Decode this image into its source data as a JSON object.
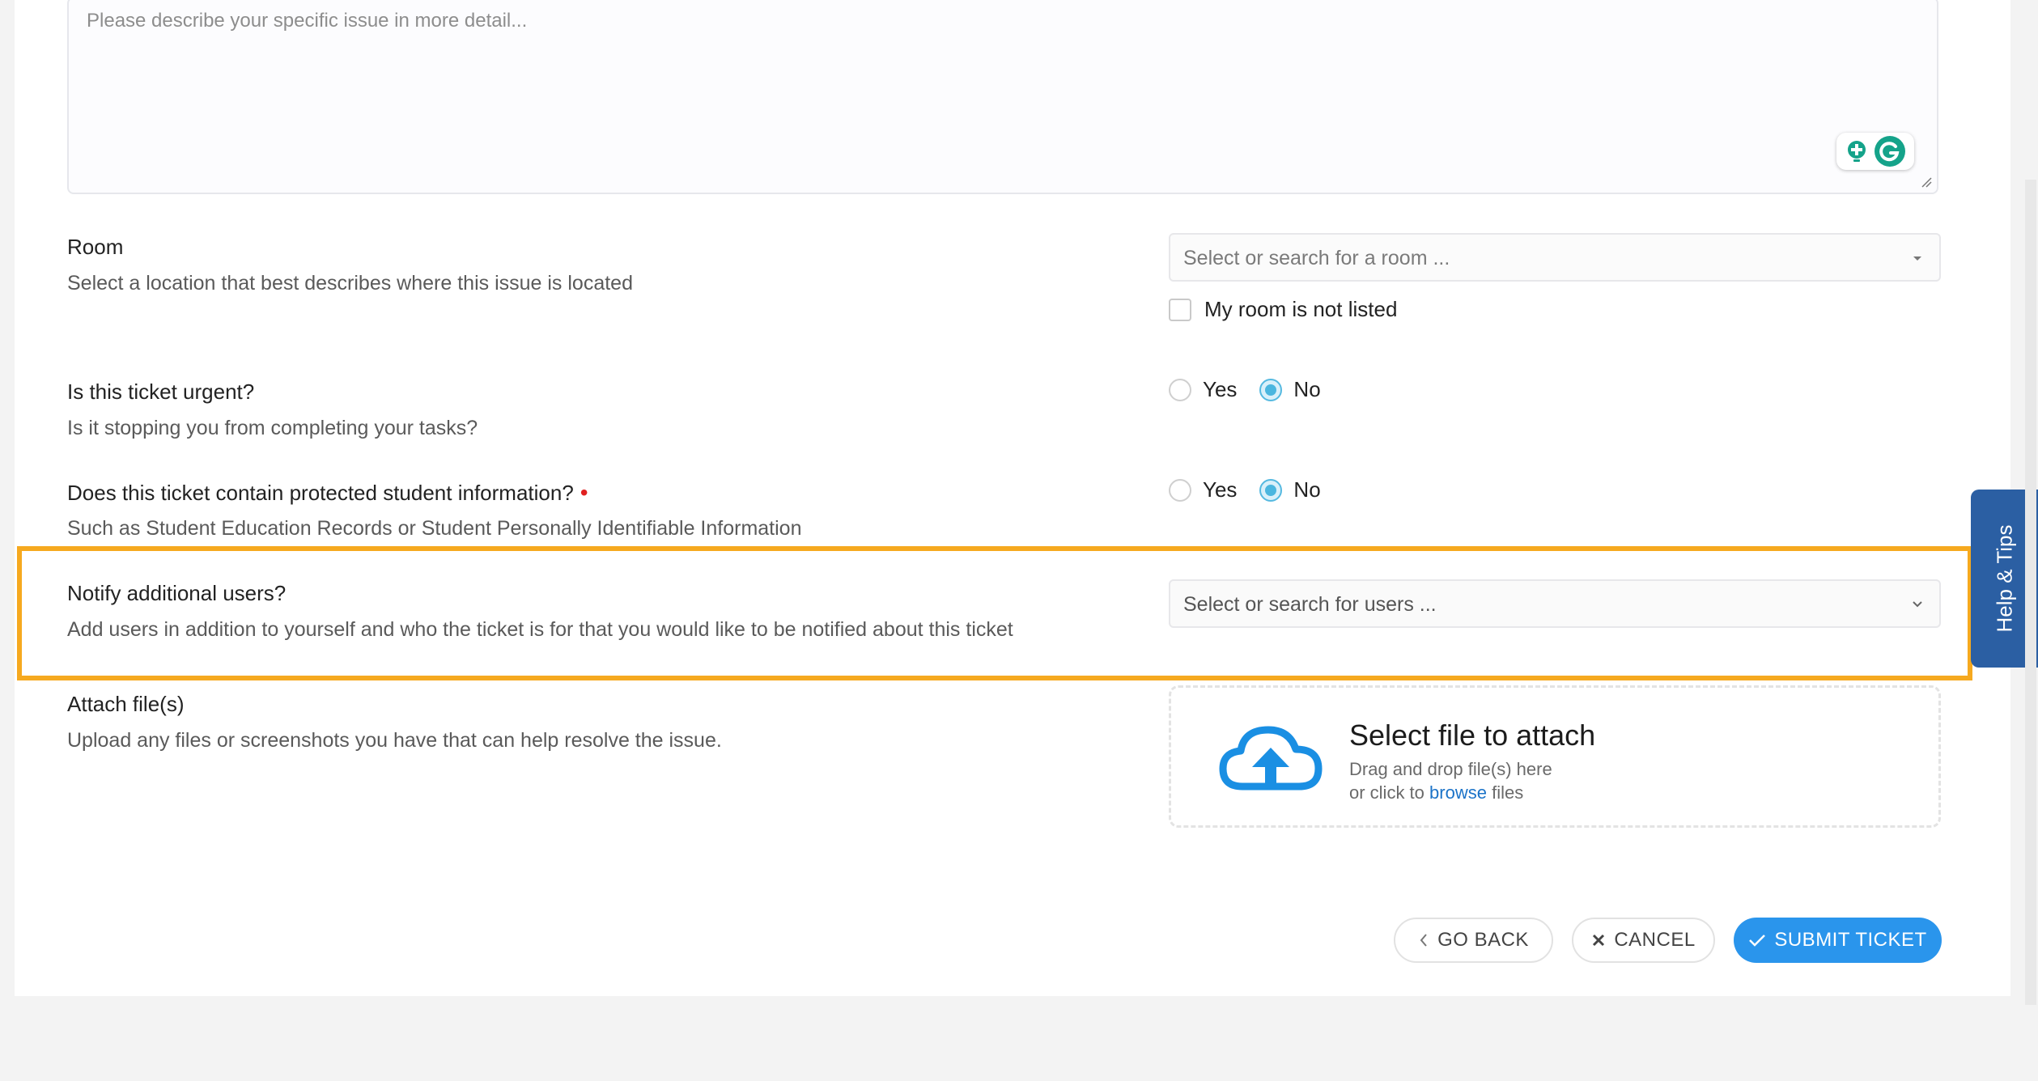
{
  "description_field": {
    "placeholder": "Please describe your specific issue in more detail..."
  },
  "room": {
    "label": "Room",
    "description": "Select a location that best describes where this issue is located",
    "select_placeholder": "Select or search for a room ...",
    "not_listed_label": "My room is not listed",
    "not_listed_checked": false
  },
  "urgent": {
    "label": "Is this ticket urgent?",
    "description": "Is it stopping you from completing your tasks?",
    "yes_label": "Yes",
    "no_label": "No",
    "selected": "No"
  },
  "protected_info": {
    "label": "Does this ticket contain protected student information?",
    "required_marker": "•",
    "description": "Such as Student Education Records or Student Personally Identifiable Information",
    "yes_label": "Yes",
    "no_label": "No",
    "selected": "No"
  },
  "notify_users": {
    "label": "Notify additional users?",
    "description": "Add users in addition to yourself and who the ticket is for that you would like to be notified about this ticket",
    "select_placeholder": "Select or search for users ..."
  },
  "attach": {
    "label": "Attach file(s)",
    "description": "Upload any files or screenshots you have that can help resolve the issue.",
    "dropzone_title": "Select file to attach",
    "dropzone_line1": "Drag and drop file(s) here",
    "dropzone_line2_prefix": "or click to",
    "dropzone_link": "browse",
    "dropzone_line2_suffix": "files"
  },
  "buttons": {
    "go_back": "GO BACK",
    "cancel": "CANCEL",
    "submit": "SUBMIT TICKET"
  },
  "help_tab": {
    "label": "Help & Tips"
  },
  "colors": {
    "highlight": "#f6a91f",
    "primary": "#2a95ec",
    "help_tab": "#2b5fa3",
    "radio_selected": "#4bb6df",
    "cloud_icon": "#1a8fe3"
  }
}
